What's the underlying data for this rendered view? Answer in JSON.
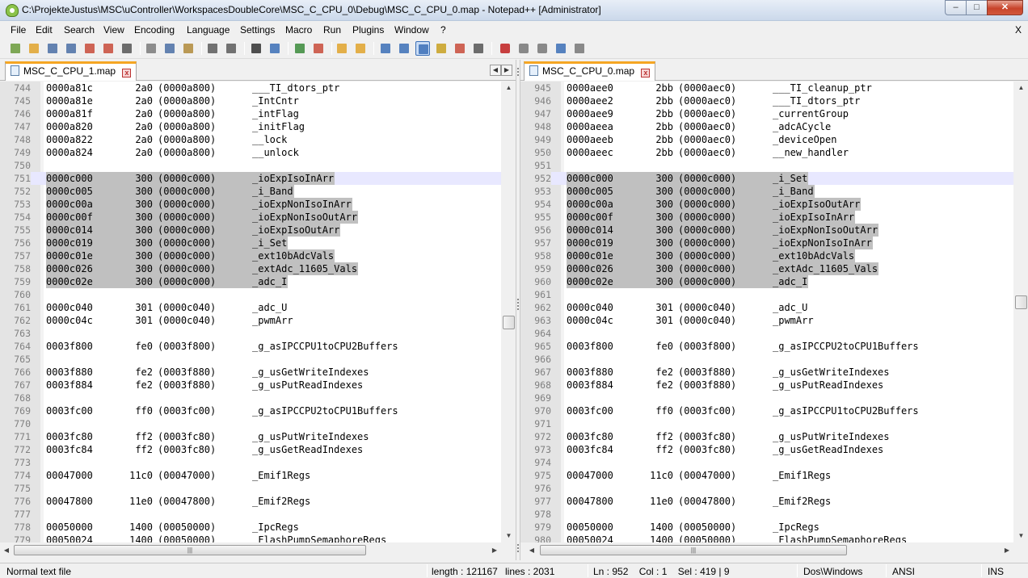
{
  "window": {
    "title": "C:\\ProjekteJustus\\MSC\\uController\\WorkspacesDoubleCore\\MSC_C_CPU_0\\Debug\\MSC_C_CPU_0.map - Notepad++ [Administrator]",
    "minimize": "–",
    "maximize": "□",
    "close": "✕"
  },
  "menu": {
    "items": [
      "File",
      "Edit",
      "Search",
      "View",
      "Encoding",
      "Language",
      "Settings",
      "Macro",
      "Run",
      "Plugins",
      "Window",
      "?"
    ],
    "close": "X"
  },
  "toolbar": {
    "icons": [
      "new-file-icon",
      "open-file-icon",
      "save-icon",
      "save-all-icon",
      "close-icon",
      "close-all-icon",
      "print-icon",
      "cut-icon",
      "copy-icon",
      "paste-icon",
      "undo-icon",
      "redo-icon",
      "find-icon",
      "replace-icon",
      "zoom-in-icon",
      "zoom-out-icon",
      "sync-vertical-icon",
      "sync-horizontal-icon",
      "word-wrap-icon",
      "show-all-chars-icon",
      "indent-guide-icon",
      "user-language-icon",
      "doc-map-icon",
      "function-list-icon",
      "record-macro-icon",
      "stop-macro-icon",
      "play-macro-icon",
      "run-macro-multiple-icon",
      "save-macro-icon"
    ]
  },
  "left": {
    "tab": "MSC_C_CPU_1.map",
    "lines": [
      {
        "n": "744",
        "addr": "0000a81c",
        "page": "2a0",
        "orig": "(0000a800)",
        "sym": "___TI_dtors_ptr",
        "sel": false
      },
      {
        "n": "745",
        "addr": "0000a81e",
        "page": "2a0",
        "orig": "(0000a800)",
        "sym": "_IntCntr",
        "sel": false
      },
      {
        "n": "746",
        "addr": "0000a81f",
        "page": "2a0",
        "orig": "(0000a800)",
        "sym": "_intFlag",
        "sel": false
      },
      {
        "n": "747",
        "addr": "0000a820",
        "page": "2a0",
        "orig": "(0000a800)",
        "sym": "_initFlag",
        "sel": false
      },
      {
        "n": "748",
        "addr": "0000a822",
        "page": "2a0",
        "orig": "(0000a800)",
        "sym": "__lock",
        "sel": false
      },
      {
        "n": "749",
        "addr": "0000a824",
        "page": "2a0",
        "orig": "(0000a800)",
        "sym": "__unlock",
        "sel": false
      },
      {
        "n": "750",
        "addr": "",
        "page": "",
        "orig": "",
        "sym": "",
        "sel": false
      },
      {
        "n": "751",
        "addr": "0000c000",
        "page": "300",
        "orig": "(0000c000)",
        "sym": "_ioExpIsoInArr",
        "sel": true,
        "cur": true
      },
      {
        "n": "752",
        "addr": "0000c005",
        "page": "300",
        "orig": "(0000c000)",
        "sym": "_i_Band",
        "sel": true
      },
      {
        "n": "753",
        "addr": "0000c00a",
        "page": "300",
        "orig": "(0000c000)",
        "sym": "_ioExpNonIsoInArr",
        "sel": true
      },
      {
        "n": "754",
        "addr": "0000c00f",
        "page": "300",
        "orig": "(0000c000)",
        "sym": "_ioExpNonIsoOutArr",
        "sel": true
      },
      {
        "n": "755",
        "addr": "0000c014",
        "page": "300",
        "orig": "(0000c000)",
        "sym": "_ioExpIsoOutArr",
        "sel": true
      },
      {
        "n": "756",
        "addr": "0000c019",
        "page": "300",
        "orig": "(0000c000)",
        "sym": "_i_Set",
        "sel": true
      },
      {
        "n": "757",
        "addr": "0000c01e",
        "page": "300",
        "orig": "(0000c000)",
        "sym": "_ext10bAdcVals",
        "sel": true
      },
      {
        "n": "758",
        "addr": "0000c026",
        "page": "300",
        "orig": "(0000c000)",
        "sym": "_extAdc_11605_Vals",
        "sel": true
      },
      {
        "n": "759",
        "addr": "0000c02e",
        "page": "300",
        "orig": "(0000c000)",
        "sym": "_adc_I",
        "sel": true
      },
      {
        "n": "760",
        "addr": "",
        "page": "",
        "orig": "",
        "sym": "",
        "sel": false
      },
      {
        "n": "761",
        "addr": "0000c040",
        "page": "301",
        "orig": "(0000c040)",
        "sym": "_adc_U",
        "sel": false
      },
      {
        "n": "762",
        "addr": "0000c04c",
        "page": "301",
        "orig": "(0000c040)",
        "sym": "_pwmArr",
        "sel": false
      },
      {
        "n": "763",
        "addr": "",
        "page": "",
        "orig": "",
        "sym": "",
        "sel": false
      },
      {
        "n": "764",
        "addr": "0003f800",
        "page": "fe0",
        "orig": "(0003f800)",
        "sym": "_g_asIPCCPU1toCPU2Buffers",
        "sel": false
      },
      {
        "n": "765",
        "addr": "",
        "page": "",
        "orig": "",
        "sym": "",
        "sel": false
      },
      {
        "n": "766",
        "addr": "0003f880",
        "page": "fe2",
        "orig": "(0003f880)",
        "sym": "_g_usGetWriteIndexes",
        "sel": false
      },
      {
        "n": "767",
        "addr": "0003f884",
        "page": "fe2",
        "orig": "(0003f880)",
        "sym": "_g_usPutReadIndexes",
        "sel": false
      },
      {
        "n": "768",
        "addr": "",
        "page": "",
        "orig": "",
        "sym": "",
        "sel": false
      },
      {
        "n": "769",
        "addr": "0003fc00",
        "page": "ff0",
        "orig": "(0003fc00)",
        "sym": "_g_asIPCCPU2toCPU1Buffers",
        "sel": false
      },
      {
        "n": "770",
        "addr": "",
        "page": "",
        "orig": "",
        "sym": "",
        "sel": false
      },
      {
        "n": "771",
        "addr": "0003fc80",
        "page": "ff2",
        "orig": "(0003fc80)",
        "sym": "_g_usPutWriteIndexes",
        "sel": false
      },
      {
        "n": "772",
        "addr": "0003fc84",
        "page": "ff2",
        "orig": "(0003fc80)",
        "sym": "_g_usGetReadIndexes",
        "sel": false
      },
      {
        "n": "773",
        "addr": "",
        "page": "",
        "orig": "",
        "sym": "",
        "sel": false
      },
      {
        "n": "774",
        "addr": "00047000",
        "page": "11c0",
        "orig": "(00047000)",
        "sym": "_Emif1Regs",
        "sel": false
      },
      {
        "n": "775",
        "addr": "",
        "page": "",
        "orig": "",
        "sym": "",
        "sel": false
      },
      {
        "n": "776",
        "addr": "00047800",
        "page": "11e0",
        "orig": "(00047800)",
        "sym": "_Emif2Regs",
        "sel": false
      },
      {
        "n": "777",
        "addr": "",
        "page": "",
        "orig": "",
        "sym": "",
        "sel": false
      },
      {
        "n": "778",
        "addr": "00050000",
        "page": "1400",
        "orig": "(00050000)",
        "sym": "_IpcRegs",
        "sel": false
      },
      {
        "n": "779",
        "addr": "00050024",
        "page": "1400",
        "orig": "(00050000)",
        "sym": "_FlashPumpSemaphoreRegs",
        "sel": false
      }
    ]
  },
  "right": {
    "tab": "MSC_C_CPU_0.map",
    "lines": [
      {
        "n": "945",
        "addr": "0000aee0",
        "page": "2bb",
        "orig": "(0000aec0)",
        "sym": "___TI_cleanup_ptr",
        "sel": false
      },
      {
        "n": "946",
        "addr": "0000aee2",
        "page": "2bb",
        "orig": "(0000aec0)",
        "sym": "___TI_dtors_ptr",
        "sel": false
      },
      {
        "n": "947",
        "addr": "0000aee9",
        "page": "2bb",
        "orig": "(0000aec0)",
        "sym": "_currentGroup",
        "sel": false
      },
      {
        "n": "948",
        "addr": "0000aeea",
        "page": "2bb",
        "orig": "(0000aec0)",
        "sym": "_adcACycle",
        "sel": false
      },
      {
        "n": "949",
        "addr": "0000aeeb",
        "page": "2bb",
        "orig": "(0000aec0)",
        "sym": "_deviceOpen",
        "sel": false
      },
      {
        "n": "950",
        "addr": "0000aeec",
        "page": "2bb",
        "orig": "(0000aec0)",
        "sym": "__new_handler",
        "sel": false
      },
      {
        "n": "951",
        "addr": "",
        "page": "",
        "orig": "",
        "sym": "",
        "sel": false
      },
      {
        "n": "952",
        "addr": "0000c000",
        "page": "300",
        "orig": "(0000c000)",
        "sym": "_i_Set",
        "sel": true,
        "cur": true
      },
      {
        "n": "953",
        "addr": "0000c005",
        "page": "300",
        "orig": "(0000c000)",
        "sym": "_i_Band",
        "sel": true
      },
      {
        "n": "954",
        "addr": "0000c00a",
        "page": "300",
        "orig": "(0000c000)",
        "sym": "_ioExpIsoOutArr",
        "sel": true
      },
      {
        "n": "955",
        "addr": "0000c00f",
        "page": "300",
        "orig": "(0000c000)",
        "sym": "_ioExpIsoInArr",
        "sel": true
      },
      {
        "n": "956",
        "addr": "0000c014",
        "page": "300",
        "orig": "(0000c000)",
        "sym": "_ioExpNonIsoOutArr",
        "sel": true
      },
      {
        "n": "957",
        "addr": "0000c019",
        "page": "300",
        "orig": "(0000c000)",
        "sym": "_ioExpNonIsoInArr",
        "sel": true
      },
      {
        "n": "958",
        "addr": "0000c01e",
        "page": "300",
        "orig": "(0000c000)",
        "sym": "_ext10bAdcVals",
        "sel": true
      },
      {
        "n": "959",
        "addr": "0000c026",
        "page": "300",
        "orig": "(0000c000)",
        "sym": "_extAdc_11605_Vals",
        "sel": true
      },
      {
        "n": "960",
        "addr": "0000c02e",
        "page": "300",
        "orig": "(0000c000)",
        "sym": "_adc_I",
        "sel": true
      },
      {
        "n": "961",
        "addr": "",
        "page": "",
        "orig": "",
        "sym": "",
        "sel": false
      },
      {
        "n": "962",
        "addr": "0000c040",
        "page": "301",
        "orig": "(0000c040)",
        "sym": "_adc_U",
        "sel": false
      },
      {
        "n": "963",
        "addr": "0000c04c",
        "page": "301",
        "orig": "(0000c040)",
        "sym": "_pwmArr",
        "sel": false
      },
      {
        "n": "964",
        "addr": "",
        "page": "",
        "orig": "",
        "sym": "",
        "sel": false
      },
      {
        "n": "965",
        "addr": "0003f800",
        "page": "fe0",
        "orig": "(0003f800)",
        "sym": "_g_asIPCCPU2toCPU1Buffers",
        "sel": false
      },
      {
        "n": "966",
        "addr": "",
        "page": "",
        "orig": "",
        "sym": "",
        "sel": false
      },
      {
        "n": "967",
        "addr": "0003f880",
        "page": "fe2",
        "orig": "(0003f880)",
        "sym": "_g_usGetWriteIndexes",
        "sel": false
      },
      {
        "n": "968",
        "addr": "0003f884",
        "page": "fe2",
        "orig": "(0003f880)",
        "sym": "_g_usPutReadIndexes",
        "sel": false
      },
      {
        "n": "969",
        "addr": "",
        "page": "",
        "orig": "",
        "sym": "",
        "sel": false
      },
      {
        "n": "970",
        "addr": "0003fc00",
        "page": "ff0",
        "orig": "(0003fc00)",
        "sym": "_g_asIPCCPU1toCPU2Buffers",
        "sel": false
      },
      {
        "n": "971",
        "addr": "",
        "page": "",
        "orig": "",
        "sym": "",
        "sel": false
      },
      {
        "n": "972",
        "addr": "0003fc80",
        "page": "ff2",
        "orig": "(0003fc80)",
        "sym": "_g_usPutWriteIndexes",
        "sel": false
      },
      {
        "n": "973",
        "addr": "0003fc84",
        "page": "ff2",
        "orig": "(0003fc80)",
        "sym": "_g_usGetReadIndexes",
        "sel": false
      },
      {
        "n": "974",
        "addr": "",
        "page": "",
        "orig": "",
        "sym": "",
        "sel": false
      },
      {
        "n": "975",
        "addr": "00047000",
        "page": "11c0",
        "orig": "(00047000)",
        "sym": "_Emif1Regs",
        "sel": false
      },
      {
        "n": "976",
        "addr": "",
        "page": "",
        "orig": "",
        "sym": "",
        "sel": false
      },
      {
        "n": "977",
        "addr": "00047800",
        "page": "11e0",
        "orig": "(00047800)",
        "sym": "_Emif2Regs",
        "sel": false
      },
      {
        "n": "978",
        "addr": "",
        "page": "",
        "orig": "",
        "sym": "",
        "sel": false
      },
      {
        "n": "979",
        "addr": "00050000",
        "page": "1400",
        "orig": "(00050000)",
        "sym": "_IpcRegs",
        "sel": false
      },
      {
        "n": "980",
        "addr": "00050024",
        "page": "1400",
        "orig": "(00050000)",
        "sym": "_FlashPumpSemaphoreRegs",
        "sel": false
      }
    ]
  },
  "status": {
    "filetype": "Normal text file",
    "length": "length : 121167",
    "lines": "lines : 2031",
    "position": "Ln : 952    Col : 1    Sel : 419 | 9",
    "eol": "Dos\\Windows",
    "encoding": "ANSI",
    "mode": "INS"
  },
  "colors": {
    "selection": "#c0c0c0",
    "current_line": "#e8e8ff",
    "active_tab_accent": "#f5a623"
  }
}
